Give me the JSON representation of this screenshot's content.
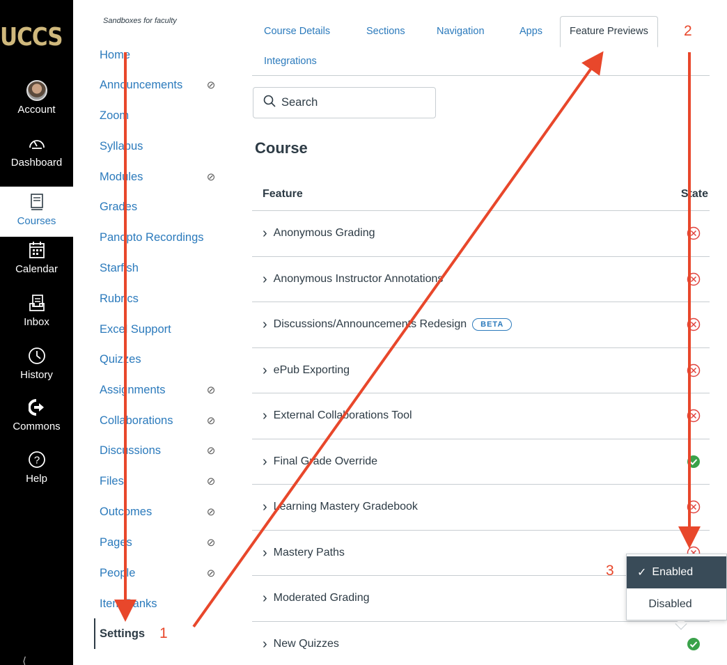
{
  "global_nav": {
    "logo": "UCCS",
    "items": [
      {
        "label": "Account",
        "icon": "avatar"
      },
      {
        "label": "Dashboard",
        "icon": "dashboard-icon"
      },
      {
        "label": "Courses",
        "icon": "courses-icon",
        "active": true
      },
      {
        "label": "Calendar",
        "icon": "calendar-icon"
      },
      {
        "label": "Inbox",
        "icon": "inbox-icon"
      },
      {
        "label": "History",
        "icon": "history-icon"
      },
      {
        "label": "Commons",
        "icon": "commons-icon"
      },
      {
        "label": "Help",
        "icon": "help-icon"
      }
    ]
  },
  "course_nav": {
    "course_name": "Sandboxes for faculty",
    "items": [
      {
        "label": "Home",
        "hidden": false
      },
      {
        "label": "Announcements",
        "hidden": true
      },
      {
        "label": "Zoom",
        "hidden": false
      },
      {
        "label": "Syllabus",
        "hidden": false
      },
      {
        "label": "Modules",
        "hidden": true
      },
      {
        "label": "Grades",
        "hidden": false
      },
      {
        "label": "Panopto Recordings",
        "hidden": false
      },
      {
        "label": "Starfish",
        "hidden": false
      },
      {
        "label": "Rubrics",
        "hidden": false
      },
      {
        "label": "Excel Support",
        "hidden": false
      },
      {
        "label": "Quizzes",
        "hidden": false
      },
      {
        "label": "Assignments",
        "hidden": true
      },
      {
        "label": "Collaborations",
        "hidden": true
      },
      {
        "label": "Discussions",
        "hidden": true
      },
      {
        "label": "Files",
        "hidden": true
      },
      {
        "label": "Outcomes",
        "hidden": true
      },
      {
        "label": "Pages",
        "hidden": true
      },
      {
        "label": "People",
        "hidden": true
      },
      {
        "label": "Item Banks",
        "hidden": false
      },
      {
        "label": "Settings",
        "hidden": false,
        "active": true
      }
    ]
  },
  "tabs": [
    {
      "label": "Course Details"
    },
    {
      "label": "Sections"
    },
    {
      "label": "Navigation"
    },
    {
      "label": "Apps"
    },
    {
      "label": "Feature Previews",
      "active": true
    },
    {
      "label": "Integrations"
    }
  ],
  "search": {
    "placeholder": "Search"
  },
  "section_title": "Course",
  "table": {
    "col_feature": "Feature",
    "col_state": "State",
    "rows": [
      {
        "name": "Anonymous Grading",
        "state": "disabled"
      },
      {
        "name": "Anonymous Instructor Annotations",
        "state": "disabled"
      },
      {
        "name": "Discussions/Announcements Redesign",
        "badge": "BETA",
        "state": "disabled"
      },
      {
        "name": "ePub Exporting",
        "state": "disabled"
      },
      {
        "name": "External Collaborations Tool",
        "state": "disabled"
      },
      {
        "name": "Final Grade Override",
        "state": "enabled"
      },
      {
        "name": "Learning Mastery Gradebook",
        "state": "disabled"
      },
      {
        "name": "Mastery Paths",
        "state": "disabled"
      },
      {
        "name": "Moderated Grading",
        "state": "none"
      },
      {
        "name": "New Quizzes",
        "state": "enabled"
      }
    ]
  },
  "state_menu": {
    "options": [
      {
        "label": "Enabled",
        "selected": true
      },
      {
        "label": "Disabled",
        "selected": false
      }
    ]
  },
  "annotations": {
    "step1": "1",
    "step2": "2",
    "step3": "3"
  },
  "colors": {
    "nav_bg": "#000000",
    "link": "#2b7abc",
    "disabled_icon": "#e0443f",
    "enabled_icon": "#3aa24a",
    "annotation": "#e8472b",
    "menu_selected_bg": "#394b58"
  }
}
